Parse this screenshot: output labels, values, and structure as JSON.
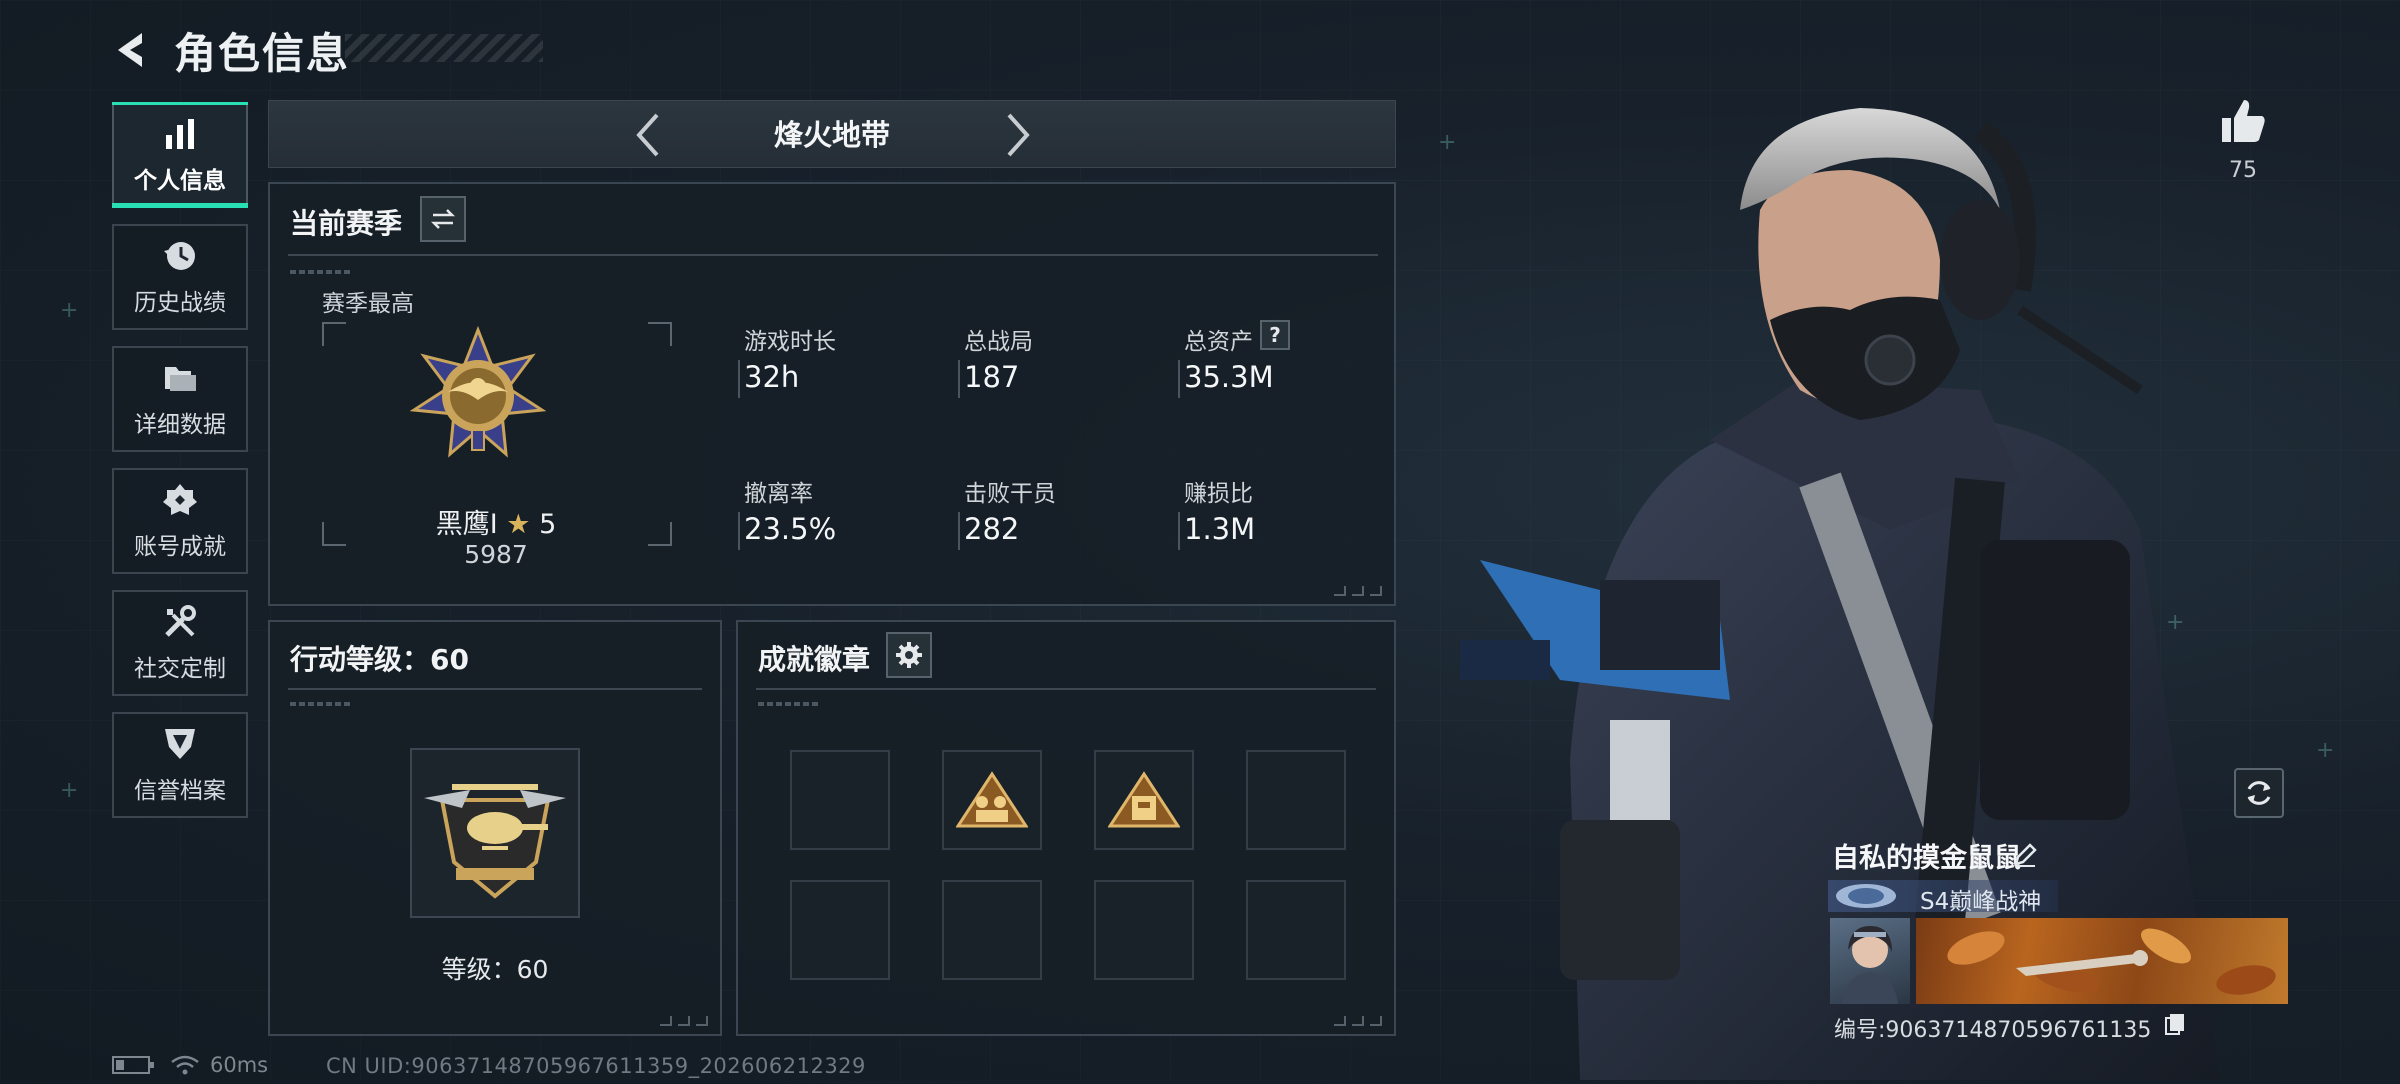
{
  "header": {
    "title": "角色信息"
  },
  "sidebar": {
    "items": [
      {
        "label": "个人信息",
        "icon": "bar-chart-icon",
        "active": true
      },
      {
        "label": "历史战绩",
        "icon": "history-icon"
      },
      {
        "label": "详细数据",
        "icon": "folder-icon"
      },
      {
        "label": "账号成就",
        "icon": "achievement-icon"
      },
      {
        "label": "社交定制",
        "icon": "tools-icon"
      },
      {
        "label": "信誉档案",
        "icon": "shield-icon"
      }
    ]
  },
  "mode": {
    "name": "烽火地带"
  },
  "season": {
    "title": "当前赛季",
    "best_label": "赛季最高",
    "rank_name": "黑鹰I",
    "rank_stars": "5",
    "rank_points": "5987",
    "stats": [
      {
        "label": "游戏时长",
        "value": "32h"
      },
      {
        "label": "总战局",
        "value": "187"
      },
      {
        "label": "总资产",
        "value": "35.3M",
        "help": "?"
      },
      {
        "label": "撤离率",
        "value": "23.5%"
      },
      {
        "label": "击败干员",
        "value": "282"
      },
      {
        "label": "赚损比",
        "value": "1.3M"
      }
    ]
  },
  "action_level": {
    "title": "行动等级：60",
    "level_text": "等级：60"
  },
  "badges": {
    "title": "成就徽章"
  },
  "profile": {
    "likes": "75",
    "player_name": "自私的摸金鼠鼠",
    "title_text": "S4巅峰战神",
    "player_id": "编号:9063714870596761135"
  },
  "status": {
    "ping": "60ms",
    "uid": "CN UID:90637148705967611359_202606212329"
  },
  "colors": {
    "accent": "#29e0b4",
    "panel_border": "#3a4651",
    "gold": "#c9a45a"
  }
}
